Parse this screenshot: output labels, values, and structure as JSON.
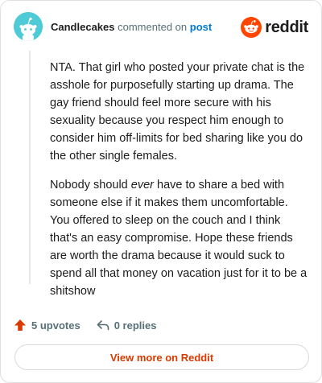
{
  "comment": {
    "username": "Candlecakes",
    "action_text": "commented on",
    "post_link_label": "post",
    "paragraph_1": "NTA. That girl who posted your private chat is the asshole for purposefully starting up drama. The gay friend should feel more secure with his sexuality because you respect him enough to consider him off-limits for bed sharing like you do the other single females.",
    "paragraph_2_before": "Nobody should ",
    "paragraph_2_emphasis": "ever",
    "paragraph_2_after": " have to share a bed with someone else if it makes them uncomfortable. You offered to sleep on the couch and I think that's an easy compromise. Hope these friends are worth the drama because it would suck to spend all that money on vacation just for it to be a shitshow"
  },
  "brand": {
    "wordmark": "reddit",
    "accent_color": "#ff4500",
    "logo_icon": "reddit-snoo-icon"
  },
  "footer": {
    "upvotes_label": "5 upvotes",
    "replies_label": "0 replies",
    "view_more_label": "View more on Reddit"
  },
  "colors": {
    "upvote": "#d93a00",
    "link": "#0079d3",
    "avatar_bg": "#4ecbd6"
  }
}
